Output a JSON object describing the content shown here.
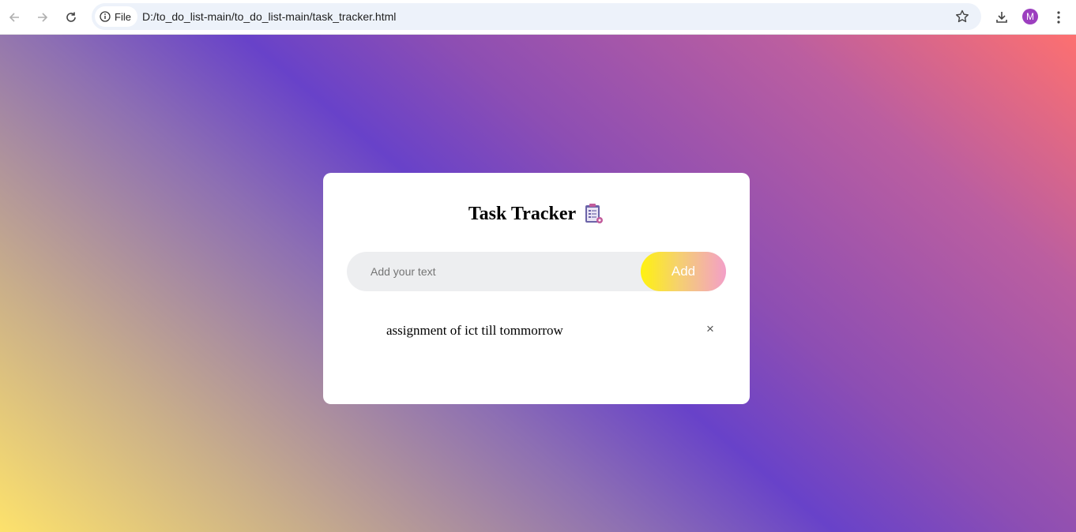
{
  "browser": {
    "site_chip_label": "File",
    "url": "D:/to_do_list-main/to_do_list-main/task_tracker.html",
    "profile_initial": "M"
  },
  "app": {
    "title": "Task Tracker",
    "title_icon": "clipboard-icon",
    "input_placeholder": "Add your text",
    "add_label": "Add",
    "tasks": [
      {
        "text": "assignment of ict till tommorrow",
        "delete_symbol": "×"
      }
    ]
  },
  "colors": {
    "gradient": [
      "#fde26c",
      "#6842c9",
      "#fd7070"
    ],
    "add_button_gradient": [
      "#fff20f",
      "#f39fc8"
    ],
    "avatar": "#9c3fbf"
  }
}
